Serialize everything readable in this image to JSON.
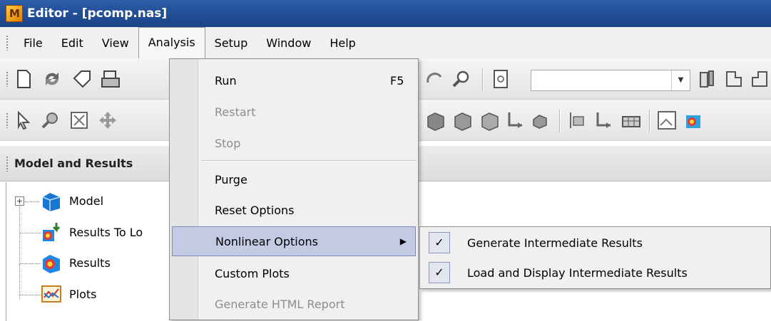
{
  "window": {
    "title": "Editor - [pcomp.nas]"
  },
  "menubar": {
    "items": [
      "File",
      "Edit",
      "View",
      "Analysis",
      "Setup",
      "Window",
      "Help"
    ],
    "active": "Analysis"
  },
  "panel": {
    "title": "Model and Results"
  },
  "tree": {
    "items": [
      {
        "label": "Model",
        "icon": "model-cube-icon"
      },
      {
        "label": "Results To Lo",
        "icon": "results-to-load-icon"
      },
      {
        "label": "Results",
        "icon": "results-icon"
      },
      {
        "label": "Plots",
        "icon": "plots-icon"
      }
    ]
  },
  "analysis_menu": {
    "items": [
      {
        "label": "Run",
        "accel": "F5",
        "enabled": true
      },
      {
        "label": "Restart",
        "enabled": false
      },
      {
        "label": "Stop",
        "enabled": false
      },
      {
        "label": "Purge",
        "enabled": true
      },
      {
        "label": "Reset Options",
        "enabled": true
      },
      {
        "label": "Nonlinear Options",
        "enabled": true,
        "submenu": true,
        "highlighted": true
      },
      {
        "label": "Custom Plots",
        "enabled": true
      },
      {
        "label": "Generate HTML Report",
        "enabled": false
      }
    ]
  },
  "nonlinear_submenu": {
    "items": [
      {
        "label": "Generate Intermediate Results",
        "checked": true,
        "check": "✓"
      },
      {
        "label": "Load and Display Intermediate Results",
        "checked": true,
        "check": "✓"
      }
    ]
  },
  "colors": {
    "titlebar": "#1f4c92",
    "highlight": "#c3cbe3",
    "disabled_text": "#8d8d8d"
  }
}
